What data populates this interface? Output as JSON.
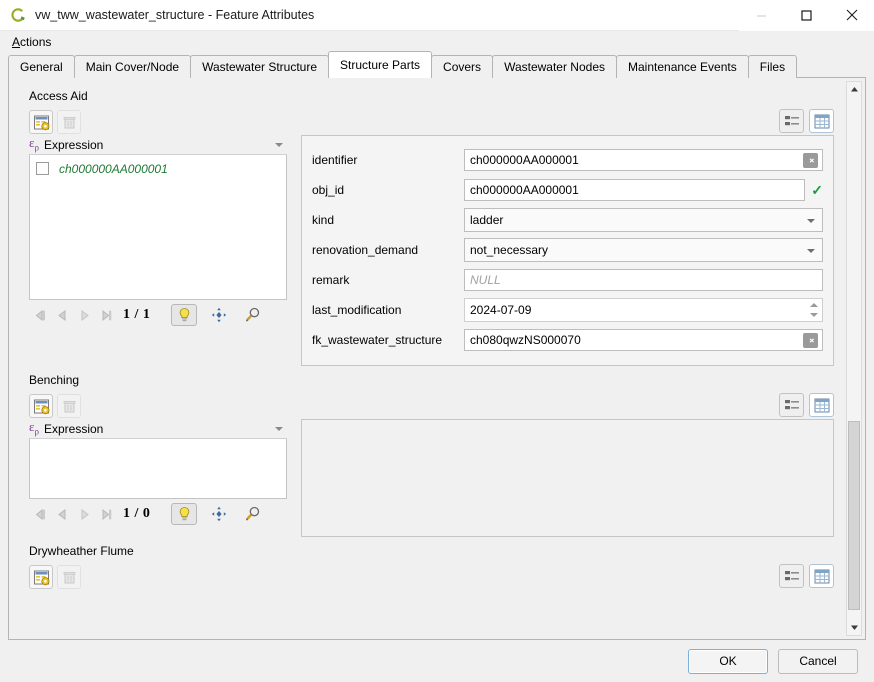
{
  "window": {
    "title": "vw_tww_wastewater_structure - Feature Attributes",
    "icon": "qgis-logo-icon",
    "controls": {
      "minimize": "minimize-icon",
      "maximize": "maximize-icon",
      "close": "close-icon"
    }
  },
  "menubar": {
    "items": [
      {
        "label": "Actions",
        "mnemonic": "A"
      }
    ]
  },
  "tabs": [
    {
      "label": "General",
      "selected": false
    },
    {
      "label": "Main Cover/Node",
      "selected": false
    },
    {
      "label": "Wastewater Structure",
      "selected": false
    },
    {
      "label": "Structure Parts",
      "selected": true
    },
    {
      "label": "Covers",
      "selected": false
    },
    {
      "label": "Wastewater Nodes",
      "selected": false
    },
    {
      "label": "Maintenance Events",
      "selected": false
    },
    {
      "label": "Files",
      "selected": false
    }
  ],
  "groups": [
    {
      "title": "Access Aid",
      "toolbar": {
        "add_label": "add-feature-icon",
        "delete_label": "delete-feature-icon",
        "form_view_label": "form-view-icon",
        "table_view_label": "table-view-icon"
      },
      "expression": {
        "label": "Expression",
        "icon": "expression-epsilon-icon"
      },
      "features": [
        {
          "label": "ch000000AA000001",
          "checked": false
        }
      ],
      "nav": {
        "counter": "1 / 1",
        "first": "first-feature-icon",
        "previous": "previous-feature-icon",
        "next": "next-feature-icon",
        "last": "last-feature-icon",
        "highlight": "highlight-bulb-icon",
        "pan": "pan-to-feature-icon",
        "zoom": "zoom-to-feature-icon"
      },
      "form": {
        "fields": [
          {
            "label": "identifier",
            "type": "text",
            "value": "ch000000AA000001",
            "clearable": true,
            "valid": false
          },
          {
            "label": "obj_id",
            "type": "text",
            "value": "ch000000AA000001",
            "clearable": false,
            "valid": true
          },
          {
            "label": "kind",
            "type": "combo",
            "value": "ladder"
          },
          {
            "label": "renovation_demand",
            "type": "combo",
            "value": "not_necessary"
          },
          {
            "label": "remark",
            "type": "text",
            "value": "",
            "placeholder": "NULL",
            "clearable": false,
            "valid": false
          },
          {
            "label": "last_modification",
            "type": "spin",
            "value": "2024-07-09"
          },
          {
            "label": "fk_wastewater_structure",
            "type": "text",
            "value": "ch080qwzNS000070",
            "clearable": true,
            "valid": false
          }
        ]
      }
    },
    {
      "title": "Benching",
      "toolbar": {
        "add_label": "add-feature-icon",
        "delete_label": "delete-feature-icon",
        "form_view_label": "form-view-icon",
        "table_view_label": "table-view-icon"
      },
      "expression": {
        "label": "Expression",
        "icon": "expression-epsilon-icon"
      },
      "features": [],
      "nav": {
        "counter": "1 / 0",
        "first": "first-feature-icon",
        "previous": "previous-feature-icon",
        "next": "next-feature-icon",
        "last": "last-feature-icon",
        "highlight": "highlight-bulb-icon",
        "pan": "pan-to-feature-icon",
        "zoom": "zoom-to-feature-icon"
      }
    },
    {
      "title": "Drywheather Flume",
      "toolbar": {
        "add_label": "add-feature-icon",
        "delete_label": "delete-feature-icon",
        "form_view_label": "form-view-icon",
        "table_view_label": "table-view-icon"
      }
    }
  ],
  "scrollbar": {
    "up_arrow": "scroll-up-icon",
    "down_arrow": "scroll-down-icon"
  },
  "buttonbox": {
    "ok_label": "OK",
    "cancel_label": "Cancel"
  },
  "colors": {
    "accent": "#79b0dc",
    "feature_text": "#1e7a32",
    "valid_check": "#1e9a3c",
    "expression_icon": "#7a3f8f"
  }
}
